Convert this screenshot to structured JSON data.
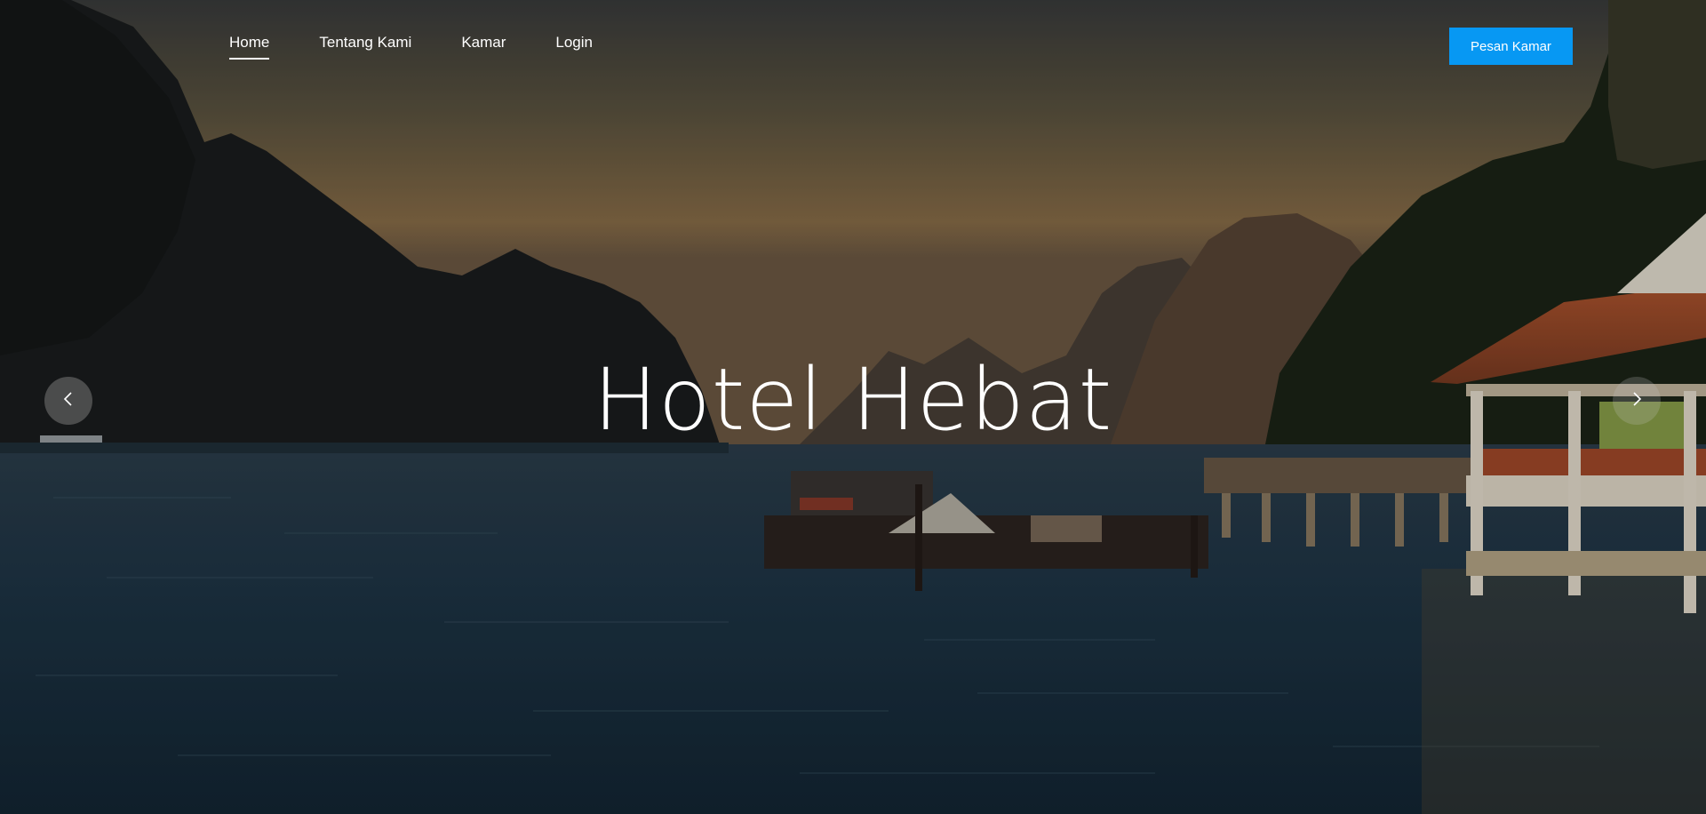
{
  "nav": {
    "items": [
      {
        "label": "Home",
        "active": true
      },
      {
        "label": "Tentang Kami",
        "active": false
      },
      {
        "label": "Kamar",
        "active": false
      },
      {
        "label": "Login",
        "active": false
      }
    ],
    "cta_label": "Pesan Kamar"
  },
  "hero": {
    "title": "Hotel Hebat"
  },
  "carousel": {
    "prev_icon": "chevron-left-icon",
    "next_icon": "chevron-right-icon"
  },
  "colors": {
    "cta_background": "#0798f3",
    "text": "#ffffff"
  }
}
